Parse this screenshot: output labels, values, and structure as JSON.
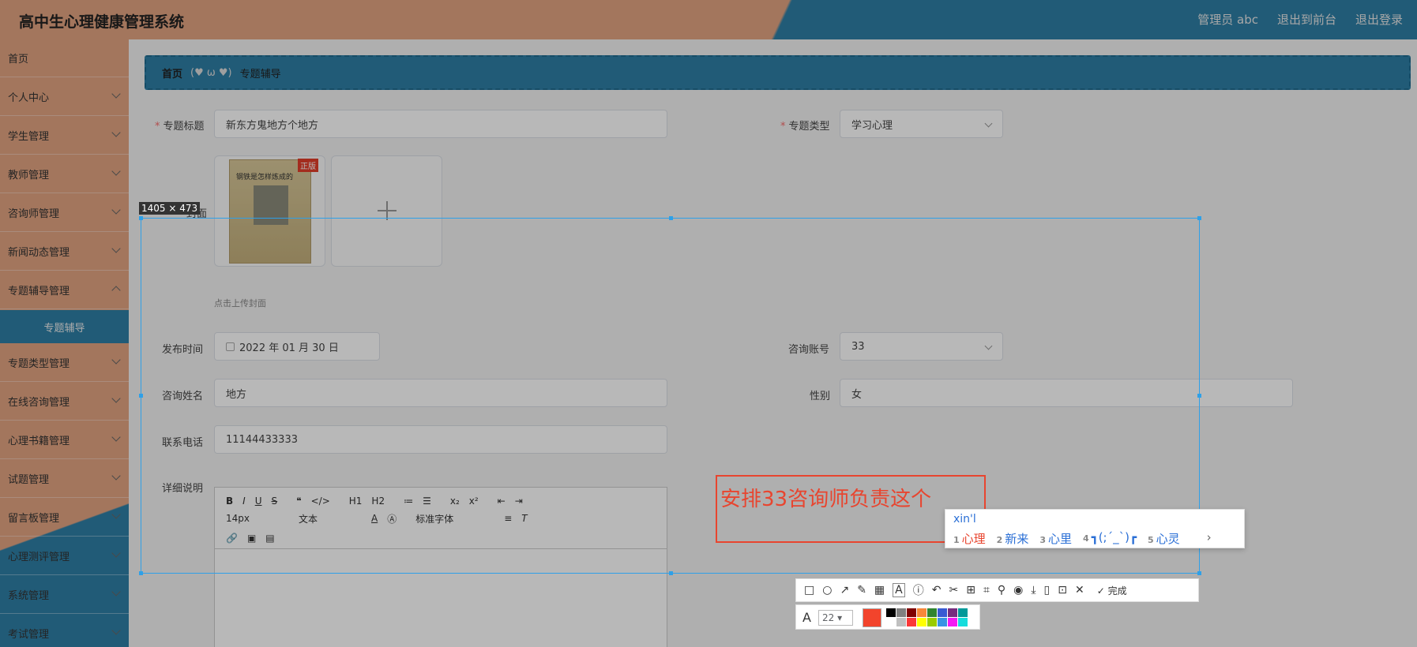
{
  "header": {
    "title": "高中生心理健康管理系统",
    "admin": "管理员 abc",
    "back_front": "退出到前台",
    "logout": "退出登录"
  },
  "sidebar": {
    "items": [
      {
        "label": "首页"
      },
      {
        "label": "个人中心"
      },
      {
        "label": "学生管理"
      },
      {
        "label": "教师管理"
      },
      {
        "label": "咨询师管理"
      },
      {
        "label": "新闻动态管理"
      },
      {
        "label": "专题辅导管理"
      },
      {
        "label": "专题类型管理"
      },
      {
        "label": "在线咨询管理"
      },
      {
        "label": "心理书籍管理"
      },
      {
        "label": "试题管理"
      },
      {
        "label": "留言板管理"
      },
      {
        "label": "心理测评管理"
      },
      {
        "label": "系统管理"
      },
      {
        "label": "考试管理"
      }
    ],
    "active_sub": "专题辅导"
  },
  "breadcrumb": {
    "home": "首页",
    "separator": "(♥ ω ♥)",
    "current": "专题辅导"
  },
  "form": {
    "title_label": "专题标题",
    "title_value": "新东方鬼地方个地方",
    "type_label": "专题类型",
    "type_value": "学习心理",
    "cover_label": "封面",
    "cover_hint": "点击上传封面",
    "book_title": "钢铁是怎样炼成的",
    "book_badge": "正版",
    "date_label": "发布时间",
    "date_value": "2022 年 01 月 30 日",
    "account_label": "咨询账号",
    "account_value": "33",
    "name_label": "咨询姓名",
    "name_value": "地方",
    "gender_label": "性别",
    "gender_value": "女",
    "phone_label": "联系电话",
    "phone_value": "11144433333",
    "detail_label": "详细说明"
  },
  "editor_toolbar": {
    "row1": [
      "B",
      "I",
      "U",
      "S",
      "❝",
      "</>",
      "H1",
      "H2",
      "≔",
      "☰",
      "x₂",
      "x²",
      "⇤",
      "⇥"
    ],
    "font_size": "14px",
    "block": "文本",
    "font": "标准字体",
    "row3": [
      "🔗",
      "▣",
      "▤"
    ]
  },
  "capture": {
    "size": "1405 × 473",
    "annotation_text": "安排33咨询师负责这个",
    "done_label": "完成",
    "font_size": "22",
    "current_color": "#f2442c",
    "swatches": [
      "#000000",
      "#808080",
      "#800000",
      "#f7883a",
      "#308430",
      "#385ad3",
      "#772d7f",
      "#009999",
      "#ffffff",
      "#c0c0c0",
      "#fb3838",
      "#ffff00",
      "#99cc00",
      "#3894e4",
      "#f31bf3",
      "#16dcdc"
    ]
  },
  "ime": {
    "input": "xin'l",
    "candidates": [
      {
        "n": "1",
        "text": "心理"
      },
      {
        "n": "2",
        "text": "新来"
      },
      {
        "n": "3",
        "text": "心里"
      },
      {
        "n": "4",
        "text": "┓(;´_`)┏"
      },
      {
        "n": "5",
        "text": "心灵"
      }
    ],
    "more": "›"
  }
}
